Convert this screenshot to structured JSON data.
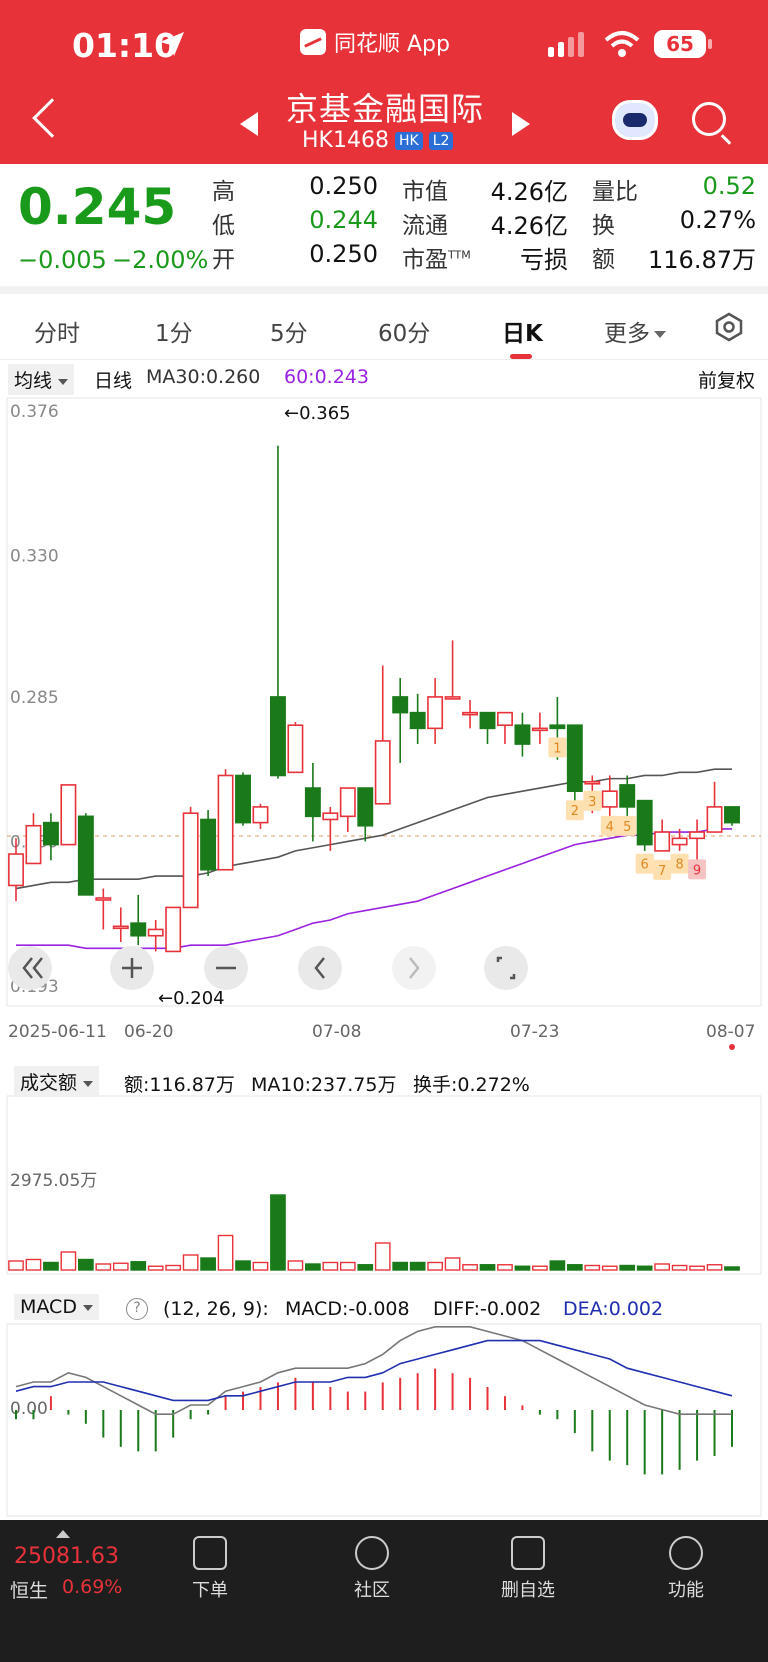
{
  "status": {
    "time": "01:10",
    "battery": "65"
  },
  "app": {
    "label": "同花顺 App"
  },
  "header": {
    "name": "京基金融国际",
    "code": "HK1468",
    "tag_hk": "HK",
    "tag_l2": "L2"
  },
  "quote": {
    "price": "0.245",
    "change": "−0.005",
    "change_pct": "−2.00%",
    "labels": {
      "high": "高",
      "low": "低",
      "open": "开",
      "mcap": "市值",
      "float": "流通",
      "pe": "市盈",
      "pe_sup": "TTM",
      "vol_ratio": "量比",
      "turnover": "换",
      "amount": "额"
    },
    "values": {
      "high": "0.250",
      "low": "0.244",
      "open": "0.250",
      "mcap": "4.26亿",
      "float": "4.26亿",
      "pe": "亏损",
      "vol_ratio": "0.52",
      "turnover": "0.27%",
      "amount": "116.87万"
    }
  },
  "tabs": [
    "分时",
    "1分",
    "5分",
    "60分",
    "日K",
    "更多"
  ],
  "active_tab": "日K",
  "ma_bar": {
    "selector": "均线",
    "period": "日线",
    "ma30": "MA30:0.260",
    "ma60": "60:0.243",
    "adjust": "前复权"
  },
  "volume_bar": {
    "selector": "成交额",
    "amount": "额:116.87万",
    "ma10": "MA10:237.75万",
    "turnover": "换手:0.272%"
  },
  "macd_bar": {
    "selector": "MACD",
    "help": "?",
    "params": "(12, 26, 9):",
    "macd": "MACD:-0.008",
    "diff": "DIFF:-0.002",
    "dea": "DEA:0.002"
  },
  "bottom": {
    "index_value": "25081.63",
    "index_name": "恒生",
    "index_pct": "0.69%",
    "nav": [
      "下单",
      "社区",
      "删自选",
      "功能"
    ]
  },
  "colors": {
    "header": "#e8323a",
    "up": "#e8323a",
    "down": "#1a7a1a",
    "ma30": "#555555",
    "ma60": "#9a22e0",
    "dea": "#1f2fb0"
  },
  "chart_data": [
    {
      "type": "candlestick",
      "y_ticks": [
        "0.376",
        "0.330",
        "0.285",
        "0.239",
        "0.193"
      ],
      "ylim": [
        0.193,
        0.376
      ],
      "x_ticks": [
        "2025-06-11",
        "06-20",
        "07-08",
        "07-23",
        "08-07"
      ],
      "annotations": {
        "max": "←0.365",
        "min": "←0.204"
      },
      "signal_labels": [
        "1",
        "2",
        "3",
        "4",
        "5",
        "6",
        "7",
        "8",
        "9"
      ],
      "candles": [
        {
          "o": 0.225,
          "h": 0.24,
          "l": 0.22,
          "c": 0.235
        },
        {
          "o": 0.232,
          "h": 0.248,
          "l": 0.232,
          "c": 0.244
        },
        {
          "o": 0.245,
          "h": 0.248,
          "l": 0.233,
          "c": 0.238
        },
        {
          "o": 0.238,
          "h": 0.257,
          "l": 0.238,
          "c": 0.257
        },
        {
          "o": 0.247,
          "h": 0.248,
          "l": 0.222,
          "c": 0.222
        },
        {
          "o": 0.221,
          "h": 0.224,
          "l": 0.211,
          "c": 0.221
        },
        {
          "o": 0.212,
          "h": 0.218,
          "l": 0.207,
          "c": 0.212
        },
        {
          "o": 0.213,
          "h": 0.222,
          "l": 0.206,
          "c": 0.209
        },
        {
          "o": 0.209,
          "h": 0.214,
          "l": 0.204,
          "c": 0.211
        },
        {
          "o": 0.204,
          "h": 0.218,
          "l": 0.204,
          "c": 0.218
        },
        {
          "o": 0.218,
          "h": 0.25,
          "l": 0.218,
          "c": 0.248
        },
        {
          "o": 0.246,
          "h": 0.249,
          "l": 0.228,
          "c": 0.23
        },
        {
          "o": 0.23,
          "h": 0.262,
          "l": 0.23,
          "c": 0.26
        },
        {
          "o": 0.26,
          "h": 0.261,
          "l": 0.244,
          "c": 0.245
        },
        {
          "o": 0.245,
          "h": 0.251,
          "l": 0.243,
          "c": 0.25
        },
        {
          "o": 0.285,
          "h": 0.365,
          "l": 0.259,
          "c": 0.26
        },
        {
          "o": 0.261,
          "h": 0.277,
          "l": 0.261,
          "c": 0.276
        },
        {
          "o": 0.256,
          "h": 0.264,
          "l": 0.239,
          "c": 0.247
        },
        {
          "o": 0.246,
          "h": 0.25,
          "l": 0.236,
          "c": 0.248
        },
        {
          "o": 0.247,
          "h": 0.256,
          "l": 0.242,
          "c": 0.256
        },
        {
          "o": 0.256,
          "h": 0.256,
          "l": 0.239,
          "c": 0.244
        },
        {
          "o": 0.251,
          "h": 0.295,
          "l": 0.251,
          "c": 0.271
        },
        {
          "o": 0.285,
          "h": 0.291,
          "l": 0.264,
          "c": 0.28
        },
        {
          "o": 0.28,
          "h": 0.286,
          "l": 0.27,
          "c": 0.275
        },
        {
          "o": 0.275,
          "h": 0.291,
          "l": 0.27,
          "c": 0.285
        },
        {
          "o": 0.285,
          "h": 0.303,
          "l": 0.285,
          "c": 0.285
        },
        {
          "o": 0.28,
          "h": 0.284,
          "l": 0.275,
          "c": 0.28
        },
        {
          "o": 0.28,
          "h": 0.28,
          "l": 0.27,
          "c": 0.275
        },
        {
          "o": 0.276,
          "h": 0.28,
          "l": 0.27,
          "c": 0.28
        },
        {
          "o": 0.276,
          "h": 0.28,
          "l": 0.266,
          "c": 0.27
        },
        {
          "o": 0.275,
          "h": 0.28,
          "l": 0.27,
          "c": 0.275
        },
        {
          "o": 0.276,
          "h": 0.285,
          "l": 0.265,
          "c": 0.275
        },
        {
          "o": 0.276,
          "h": 0.276,
          "l": 0.25,
          "c": 0.255
        },
        {
          "o": 0.258,
          "h": 0.26,
          "l": 0.248,
          "c": 0.258
        },
        {
          "o": 0.25,
          "h": 0.26,
          "l": 0.245,
          "c": 0.255
        },
        {
          "o": 0.257,
          "h": 0.26,
          "l": 0.245,
          "c": 0.25
        },
        {
          "o": 0.252,
          "h": 0.252,
          "l": 0.236,
          "c": 0.238
        },
        {
          "o": 0.236,
          "h": 0.246,
          "l": 0.236,
          "c": 0.242
        },
        {
          "o": 0.238,
          "h": 0.243,
          "l": 0.236,
          "c": 0.24
        },
        {
          "o": 0.24,
          "h": 0.246,
          "l": 0.233,
          "c": 0.242
        },
        {
          "o": 0.242,
          "h": 0.258,
          "l": 0.242,
          "c": 0.25
        },
        {
          "o": 0.25,
          "h": 0.25,
          "l": 0.244,
          "c": 0.245
        }
      ],
      "ma30": [
        0.224,
        0.225,
        0.226,
        0.226,
        0.227,
        0.227,
        0.227,
        0.227,
        0.228,
        0.228,
        0.228,
        0.229,
        0.231,
        0.232,
        0.233,
        0.234,
        0.236,
        0.237,
        0.238,
        0.239,
        0.24,
        0.241,
        0.243,
        0.245,
        0.247,
        0.249,
        0.251,
        0.253,
        0.254,
        0.255,
        0.256,
        0.257,
        0.258,
        0.258,
        0.259,
        0.259,
        0.26,
        0.26,
        0.261,
        0.261,
        0.262,
        0.262
      ],
      "ma60": [
        0.206,
        0.206,
        0.206,
        0.206,
        0.205,
        0.205,
        0.205,
        0.205,
        0.205,
        0.205,
        0.206,
        0.206,
        0.206,
        0.207,
        0.208,
        0.209,
        0.211,
        0.213,
        0.214,
        0.216,
        0.217,
        0.218,
        0.219,
        0.22,
        0.222,
        0.224,
        0.226,
        0.228,
        0.23,
        0.232,
        0.234,
        0.236,
        0.238,
        0.239,
        0.24,
        0.241,
        0.241,
        0.242,
        0.242,
        0.242,
        0.243,
        0.243
      ]
    },
    {
      "type": "bar",
      "title": "成交额",
      "y_ticks": [
        "2975.05万"
      ],
      "values": [
        60,
        70,
        50,
        120,
        70,
        40,
        45,
        55,
        25,
        30,
        100,
        80,
        230,
        60,
        50,
        500,
        60,
        40,
        50,
        50,
        35,
        180,
        50,
        50,
        50,
        80,
        35,
        35,
        35,
        25,
        25,
        60,
        35,
        30,
        25,
        30,
        25,
        40,
        30,
        25,
        35,
        20
      ]
    },
    {
      "type": "line",
      "title": "MACD",
      "y_ticks": [
        "0.00"
      ],
      "diff": [
        0.004,
        0.005,
        0.005,
        0.007,
        0.006,
        0.004,
        0.002,
        0.0,
        -0.002,
        -0.002,
        0.0,
        0.0,
        0.003,
        0.004,
        0.005,
        0.007,
        0.008,
        0.008,
        0.008,
        0.008,
        0.009,
        0.011,
        0.014,
        0.016,
        0.017,
        0.017,
        0.017,
        0.016,
        0.015,
        0.014,
        0.012,
        0.01,
        0.008,
        0.006,
        0.004,
        0.002,
        0.0,
        -0.001,
        -0.002,
        -0.002,
        -0.002,
        -0.002
      ],
      "dea": [
        0.003,
        0.004,
        0.004,
        0.005,
        0.005,
        0.005,
        0.004,
        0.003,
        0.002,
        0.001,
        0.001,
        0.001,
        0.002,
        0.002,
        0.003,
        0.004,
        0.005,
        0.005,
        0.005,
        0.006,
        0.006,
        0.007,
        0.009,
        0.01,
        0.011,
        0.012,
        0.013,
        0.014,
        0.014,
        0.014,
        0.014,
        0.013,
        0.012,
        0.011,
        0.01,
        0.008,
        0.007,
        0.006,
        0.005,
        0.004,
        0.003,
        0.002
      ],
      "macd": [
        -0.002,
        -0.002,
        0.003,
        -0.001,
        -0.003,
        -0.006,
        -0.008,
        -0.009,
        -0.009,
        -0.006,
        -0.002,
        -0.001,
        0.003,
        0.004,
        0.005,
        0.006,
        0.007,
        0.006,
        0.005,
        0.004,
        0.004,
        0.006,
        0.007,
        0.008,
        0.009,
        0.008,
        0.007,
        0.005,
        0.003,
        0.001,
        -0.001,
        -0.002,
        -0.005,
        -0.009,
        -0.011,
        -0.012,
        -0.014,
        -0.014,
        -0.013,
        -0.011,
        -0.01,
        -0.008
      ]
    }
  ]
}
